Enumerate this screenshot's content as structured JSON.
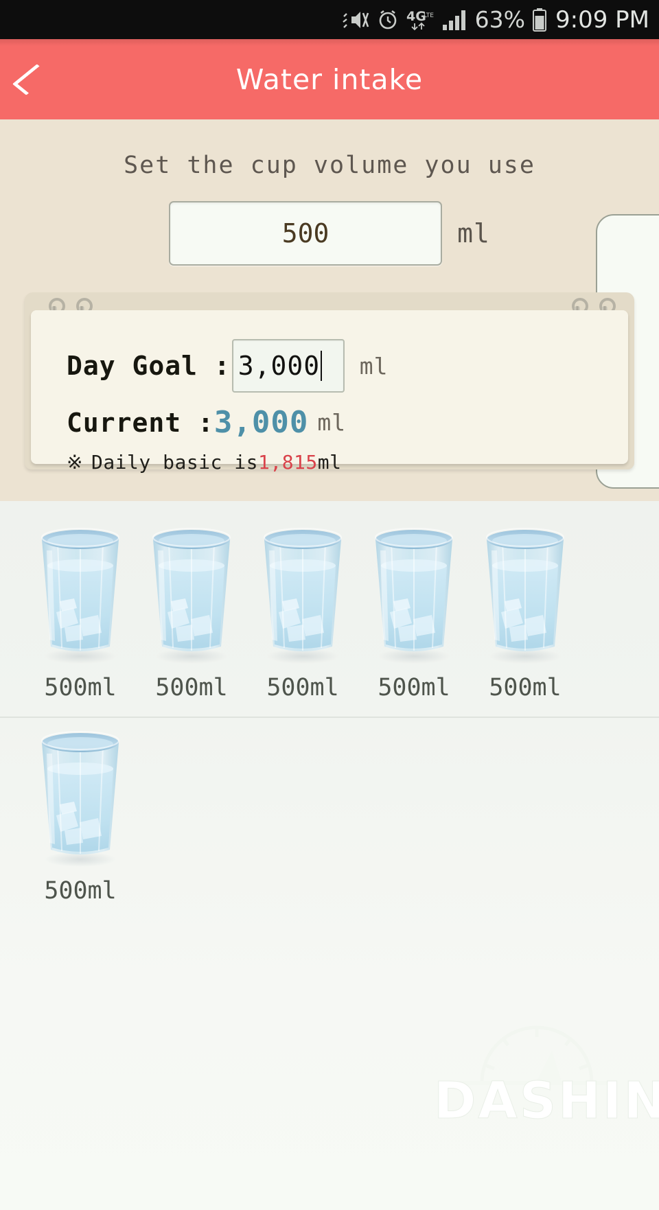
{
  "status_bar": {
    "icons": [
      "mute-icon",
      "alarm-icon",
      "4g-lte-icon",
      "signal-bars-icon"
    ],
    "network": "4G",
    "battery_percent": "63%",
    "time": "9:09 PM"
  },
  "header": {
    "title": "Water intake",
    "back_icon": "back-chevron-icon",
    "accent_color": "#f66a67"
  },
  "cup_setting": {
    "label": "Set the cup volume you use",
    "value": "500",
    "placeholder": "500",
    "unit": "ml"
  },
  "notepad": {
    "day_goal_label": "Day Goal :",
    "day_goal_value": "3,000",
    "day_goal_unit": "ml",
    "current_label": "Current :",
    "current_value": "3,000",
    "current_unit": "ml",
    "current_color": "#4e90a8",
    "note_marker": "※",
    "note_prefix": "Daily basic is",
    "note_value": "1,815",
    "note_suffix": "ml",
    "note_value_color": "#d9424a"
  },
  "glasses": {
    "row1": [
      {
        "label": "500ml"
      },
      {
        "label": "500ml"
      },
      {
        "label": "500ml"
      },
      {
        "label": "500ml"
      },
      {
        "label": "500ml"
      }
    ],
    "row2": [
      {
        "label": "500ml"
      }
    ]
  },
  "watermark": {
    "text": "DASHIN",
    "icon": "gauge-icon"
  }
}
